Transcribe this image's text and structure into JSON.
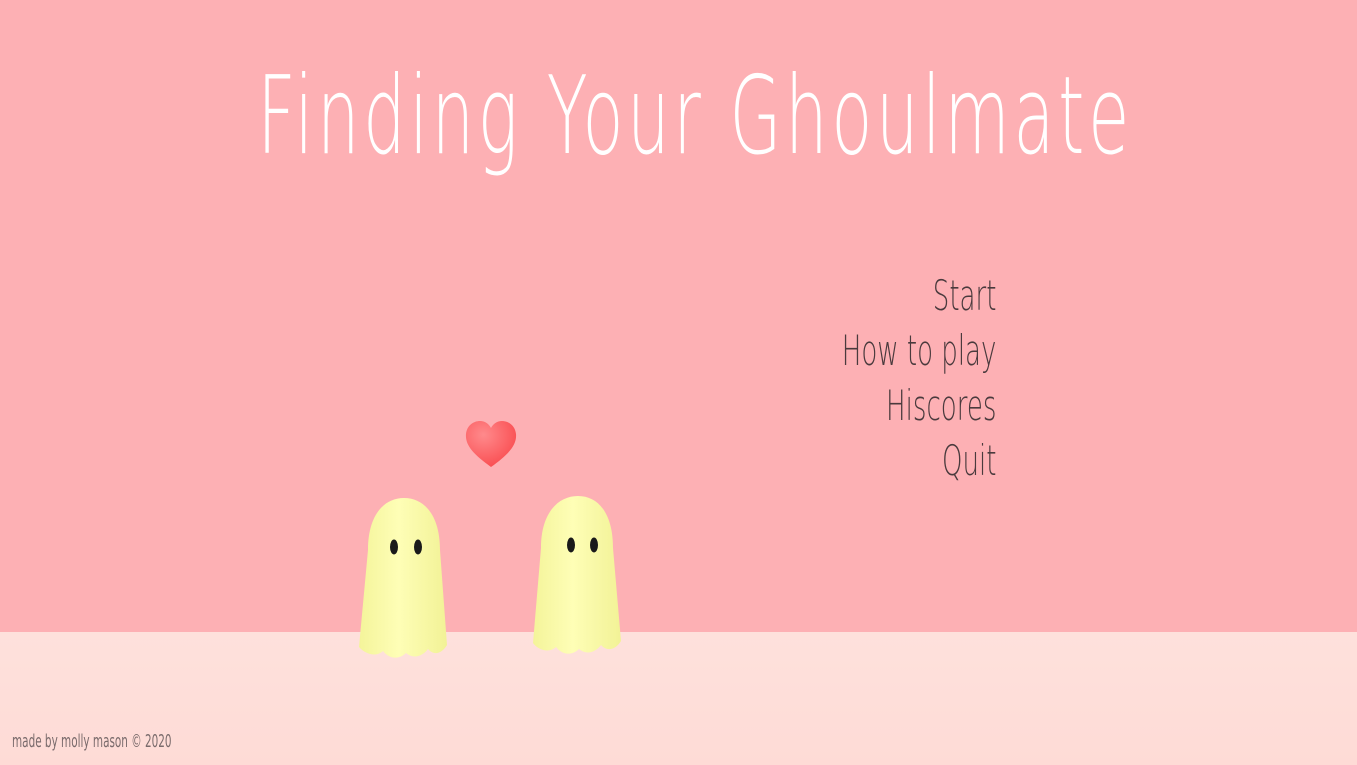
{
  "game": {
    "title": "Finding Your Ghoulmate",
    "credit": "made by molly mason © 2020"
  },
  "menu": {
    "items": [
      {
        "id": "start",
        "label": "Start"
      },
      {
        "id": "how-to-play",
        "label": "How to play"
      },
      {
        "id": "hiscores",
        "label": "Hiscores"
      },
      {
        "id": "quit",
        "label": "Quit"
      }
    ]
  },
  "scene": {
    "ghosts": [
      {
        "id": "left",
        "icon": "ghost-icon",
        "color": "#fdfdb2"
      },
      {
        "id": "right",
        "icon": "ghost-icon",
        "color": "#fdfdb2"
      }
    ],
    "heart": {
      "icon": "heart-icon",
      "color": "#fb5a5e"
    }
  },
  "colors": {
    "background": "#fdb0b4",
    "floor": "#fedfda",
    "title": "#ffffff",
    "menu_text": "#4a3a3d",
    "credit_text": "#7a6b6c"
  }
}
